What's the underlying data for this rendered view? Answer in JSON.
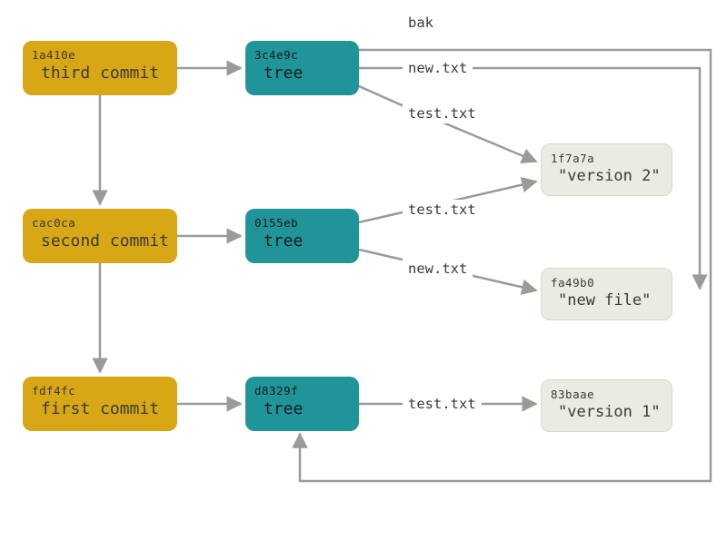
{
  "commits": [
    {
      "hash": "1a410e",
      "label": "third commit"
    },
    {
      "hash": "cac0ca",
      "label": "second commit"
    },
    {
      "hash": "fdf4fc",
      "label": "first commit"
    }
  ],
  "trees": [
    {
      "hash": "3c4e9c",
      "label": "tree"
    },
    {
      "hash": "0155eb",
      "label": "tree"
    },
    {
      "hash": "d8329f",
      "label": "tree"
    }
  ],
  "blobs": [
    {
      "hash": "1f7a7a",
      "label": "\"version 2\""
    },
    {
      "hash": "fa49b0",
      "label": "\"new file\""
    },
    {
      "hash": "83baae",
      "label": "\"version 1\""
    }
  ],
  "edgeLabels": {
    "bak": "bak",
    "newtxt": "new.txt",
    "testtxt": "test.txt"
  },
  "colors": {
    "commit": "#d8a716",
    "tree": "#1f9599",
    "blob": "#ebebe2",
    "arrow": "#9a9a9a"
  }
}
